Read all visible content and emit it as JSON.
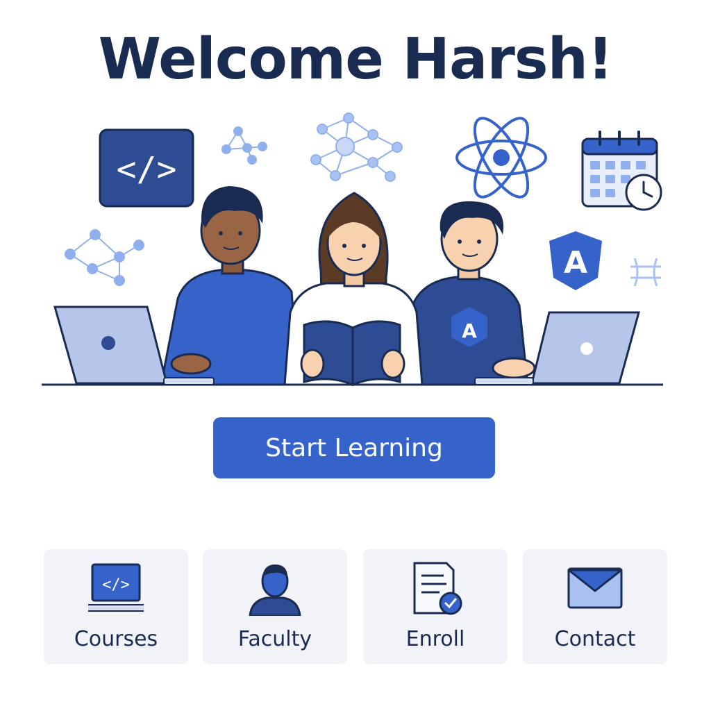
{
  "header": {
    "title": "Welcome Harsh!"
  },
  "hero": {
    "code_badge": "</>",
    "angular_badge": "A",
    "shirt_badge": "A"
  },
  "cta": {
    "label": "Start Learning"
  },
  "nav_tiles": [
    {
      "label": "Courses",
      "icon": "code-laptop-icon",
      "glyph": "</>"
    },
    {
      "label": "Faculty",
      "icon": "person-icon"
    },
    {
      "label": "Enroll",
      "icon": "document-check-icon"
    },
    {
      "label": "Contact",
      "icon": "envelope-icon"
    }
  ],
  "colors": {
    "title": "#1a2b52",
    "accent": "#3563c9",
    "tile_bg": "#f1f3f9",
    "light_blue": "#8fb0ec"
  }
}
